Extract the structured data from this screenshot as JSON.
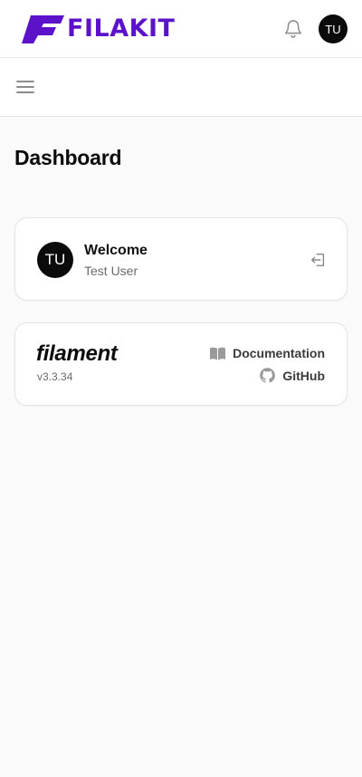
{
  "app": {
    "brand_name": "FILAKIT",
    "brand_color": "#5b12c9"
  },
  "topbar": {
    "bell_icon": "bell-icon",
    "avatar_initials": "TU"
  },
  "subbar": {
    "menu_icon": "hamburger-icon"
  },
  "page": {
    "title": "Dashboard"
  },
  "welcome_card": {
    "avatar_initials": "TU",
    "title": "Welcome",
    "user_name": "Test User",
    "signout_icon": "sign-out-icon"
  },
  "filament_card": {
    "logo_text": "filament",
    "version": "v3.3.34",
    "documentation_label": "Documentation",
    "documentation_icon": "book-open-icon",
    "github_label": "GitHub",
    "github_icon": "github-icon"
  }
}
